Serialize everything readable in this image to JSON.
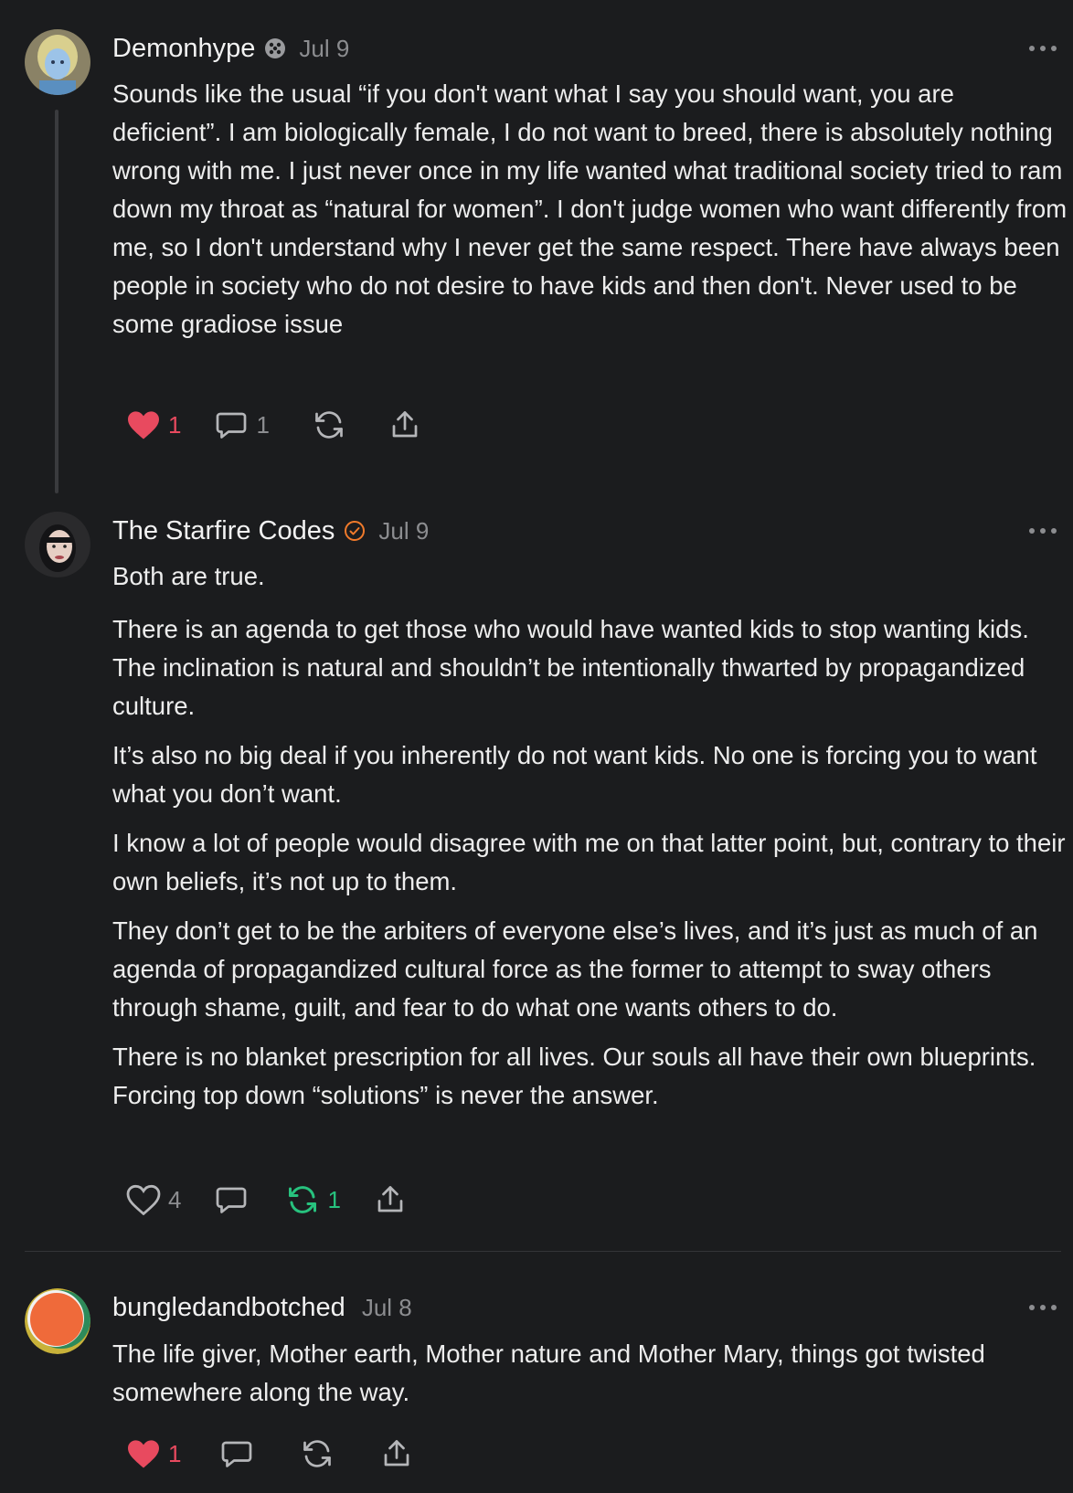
{
  "comments": [
    {
      "author": "Demonhype",
      "date": "Jul 9",
      "paragraphs": [
        "Sounds like the usual “if you don't want what I say you should want, you are deficient”. I am biologically female, I do not want to breed, there is absolutely nothing wrong with me. I just never once in my life wanted what traditional society tried to ram down my throat as “natural for women”. I don't judge women who want differently from me, so I don't understand why I never get the same respect. There have always been people in society who do not desire to have kids and then don't. Never used to be some gradiose issue"
      ],
      "likes": "1",
      "replies": "1",
      "liked": true
    },
    {
      "author": "The Starfire Codes",
      "date": "Jul 9",
      "paragraphs": [
        "Both are true.",
        "There is an agenda to get those who would have wanted kids to stop wanting kids. The inclination is natural and shouldn’t be intentionally thwarted by propagandized culture.",
        "It’s also no big deal if you inherently do not want kids. No one is forcing you to want what you don’t want.",
        "I know a lot of people would disagree with me on that latter point, but, contrary to their own beliefs, it’s not up to them.",
        "They don’t get to be the arbiters of everyone else’s lives, and it’s just as much of an agenda of propagandized cultural force as the former to attempt to sway others through shame, guilt, and fear to do what one wants others to do.",
        "There is no blanket prescription for all lives. Our souls all have their own blueprints. Forcing top down “solutions” is never the answer."
      ],
      "likes": "4",
      "restacks": "1",
      "restacked": true
    },
    {
      "author": "bungledandbotched",
      "date": "Jul 8",
      "paragraphs": [
        "The life giver, Mother earth, Mother nature and Mother Mary, things got twisted somewhere along the way."
      ],
      "likes": "1",
      "liked": true
    }
  ],
  "colors": {
    "background": "#1b1c1e",
    "text": "#ededed",
    "muted": "#8c8d90",
    "like_red": "#e84a5f",
    "restack_green": "#27c27e",
    "verified_orange": "#f07a2b"
  },
  "icons": [
    "heart-icon",
    "comment-icon",
    "restack-icon",
    "share-icon",
    "more-icon",
    "subscriber-badge-icon",
    "verified-badge-icon"
  ]
}
